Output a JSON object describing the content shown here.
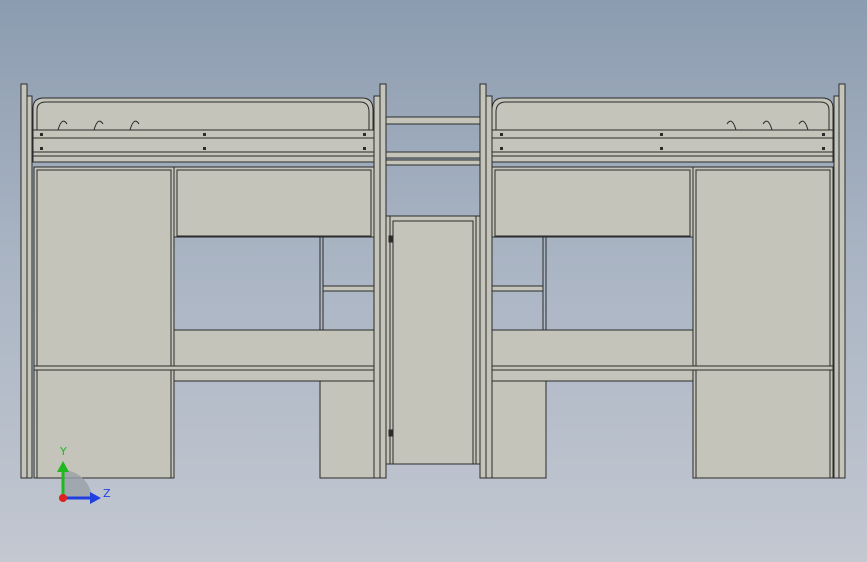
{
  "viewport": {
    "background_top": "#8c9cb0",
    "background_bottom": "#c3c8d1",
    "model_fill": "#c4c4bb",
    "edge_color": "#2b2b2b"
  },
  "triad": {
    "y_label": "Y",
    "z_label": "Z",
    "y_color": "#1fb81f",
    "z_color": "#1f3fe0",
    "x_color": "#e01f1f"
  }
}
